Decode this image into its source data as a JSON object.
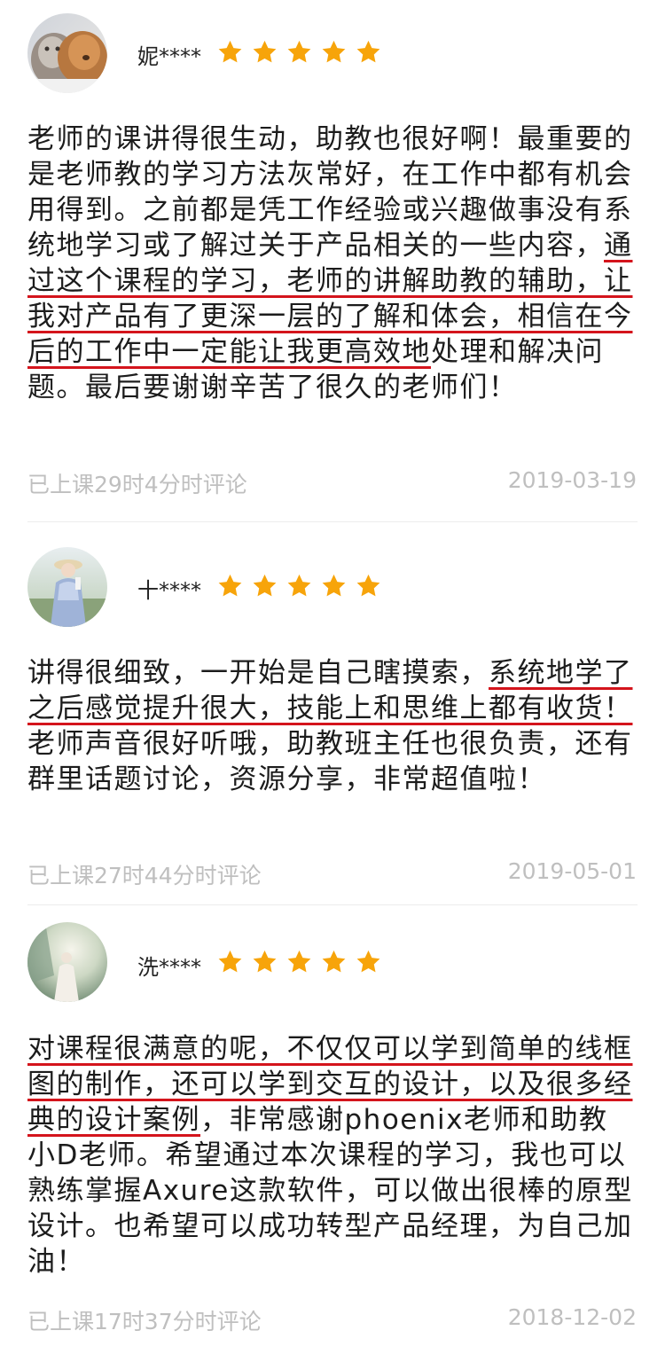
{
  "reviews": [
    {
      "username": "妮****",
      "rating": 5,
      "text_parts": [
        "老师的课讲得很生动，助教也很好啊！最重要的是老师教的学习方法灰常好，在工作中都有机会用得到。之前都是凭工作经验或兴趣做事没有系统地学习或了解过关于产品相关的一些内容，",
        "通过这个课程的学习，老师的讲解助教的辅助，让我对产品有了更深一层的了解和体会，相信在今后的工作中一定能让我更高效地",
        "处理和解决问题。最后要谢谢辛苦了很久的老师们！"
      ],
      "meta": "已上课29时4分时评论",
      "date": "2019-03-19"
    },
    {
      "username": "十****",
      "rating": 5,
      "text_parts": [
        "讲得很细致，一开始是自己瞎摸索，",
        "系统地学了之后感觉提升很大，技能上和思维上都有收货！",
        "老师声音很好听哦，助教班主任也很负责，还有群里话题讨论，资源分享，非常超值啦！"
      ],
      "meta": "已上课27时44分时评论",
      "date": "2019-05-01"
    },
    {
      "username": "洗****",
      "rating": 5,
      "text_parts": [
        "",
        "对课程很满意的呢，不仅仅可以学到简单的线框图的制作，还可以学到交互的设计，以及很多经典的设计案例",
        "，非常感谢phoenix老师和助教小D老师。希望通过本次课程的学习，我也可以熟练掌握Axure这款软件，可以做出很棒的原型设计。也希望可以成功转型产品经理，为自己加油！"
      ],
      "meta": "已上课17时37分时评论",
      "date": "2018-12-02"
    }
  ],
  "colors": {
    "star": "#f7a40a",
    "highlight_underline": "#d4141c",
    "meta_text": "#bfbfbf"
  }
}
